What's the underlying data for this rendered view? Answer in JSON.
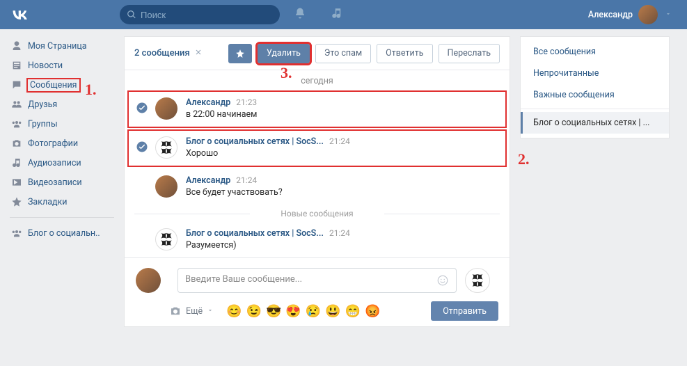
{
  "header": {
    "search_placeholder": "Поиск",
    "user_name": "Александр"
  },
  "sidebar": {
    "items": [
      {
        "label": "Моя Страница"
      },
      {
        "label": "Новости"
      },
      {
        "label": "Сообщения"
      },
      {
        "label": "Друзья"
      },
      {
        "label": "Группы"
      },
      {
        "label": "Фотографии"
      },
      {
        "label": "Аудиозаписи"
      },
      {
        "label": "Видеозаписи"
      },
      {
        "label": "Закладки"
      }
    ],
    "extra": {
      "label": "Блог о социальн.."
    }
  },
  "toolbar": {
    "selection_text": "2 сообщения",
    "delete": "Удалить",
    "spam": "Это спам",
    "reply": "Ответить",
    "forward": "Переслать"
  },
  "thread": {
    "date_label": "сегодня",
    "new_label": "Новые сообщения",
    "messages": [
      {
        "name": "Александр",
        "time": "21:23",
        "text": "в 22:00 начинаем"
      },
      {
        "name": "Блог о социальных сетях | SocS...",
        "time": "21:24",
        "text": "Хорошо"
      },
      {
        "name": "Александр",
        "time": "21:24",
        "text": "Все будет участвовать?"
      },
      {
        "name": "Блог о социальных сетях | SocS...",
        "time": "21:24",
        "text": "Разумеется)"
      }
    ]
  },
  "compose": {
    "placeholder": "Введите Ваше сообщение...",
    "attach_more": "Ещё",
    "send": "Отправить",
    "emojis": [
      "😊",
      "😉",
      "😎",
      "😍",
      "😢",
      "😃",
      "😁",
      "😡"
    ]
  },
  "filters": {
    "all": "Все сообщения",
    "unread": "Непрочитанные",
    "important": "Важные сообщения",
    "active": "Блог о социальных сетях | ..."
  },
  "annotations": {
    "a1": "1.",
    "a2": "2.",
    "a3": "3."
  }
}
